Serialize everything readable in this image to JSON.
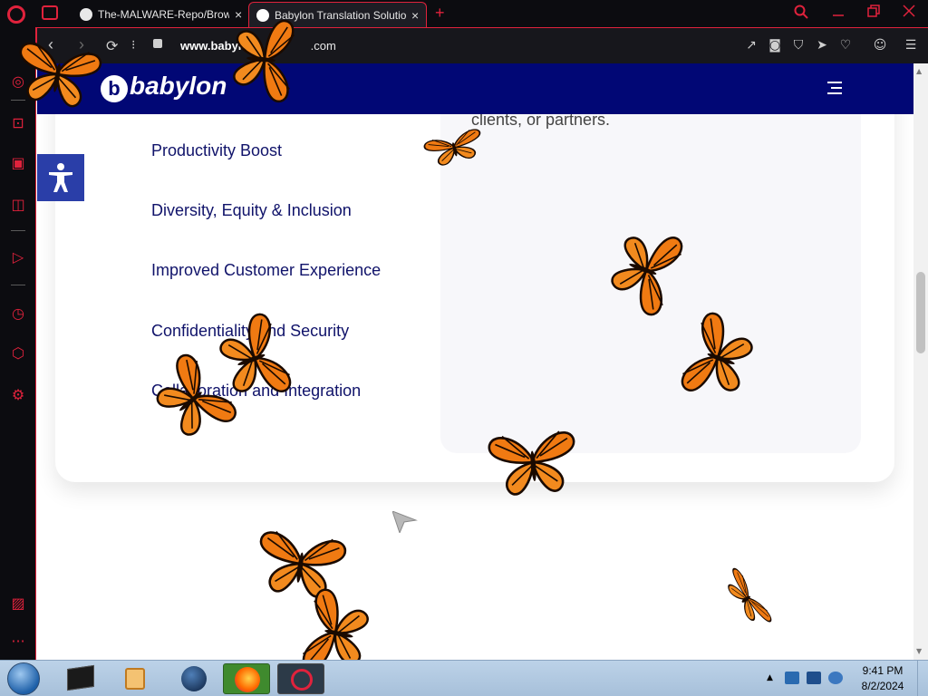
{
  "browser": {
    "tabs": [
      {
        "title": "The-MALWARE-Repo/Brow",
        "close": "×"
      },
      {
        "title": "Babylon Translation Solutio",
        "close": "×"
      }
    ],
    "new_tab": "+",
    "url_prefix": "www.babylon-",
    "url_suffix": ".com"
  },
  "site": {
    "logo_mark": "b",
    "logo_text": "babylon"
  },
  "features": [
    "Productivity Boost",
    "Diversity, Equity & Inclusion",
    "Improved Customer Experience",
    "Confidentiality and Security",
    "Collaboration and Integration"
  ],
  "description": "across language barriers, allowing individuals or businesses to engage with global audiences, clients, or partners.",
  "taskbar": {
    "time": "9:41 PM",
    "date": "8/2/2024"
  },
  "colors": {
    "header_bg": "#010775",
    "feature_text": "#10136a",
    "accent_red": "#e0223c",
    "accessibility_btn": "#2a3ea8"
  },
  "icons": {
    "sidebar": [
      "messenger-icon",
      "bag-icon",
      "twitch-icon",
      "instagram-icon",
      "player-icon",
      "history-icon",
      "box-icon",
      "settings-icon",
      "gallery-icon",
      "more-icon"
    ],
    "toolbar": [
      "share-icon",
      "camera-icon",
      "shield-icon",
      "send-icon",
      "heart-icon",
      "account-icon",
      "menu-icon"
    ]
  }
}
